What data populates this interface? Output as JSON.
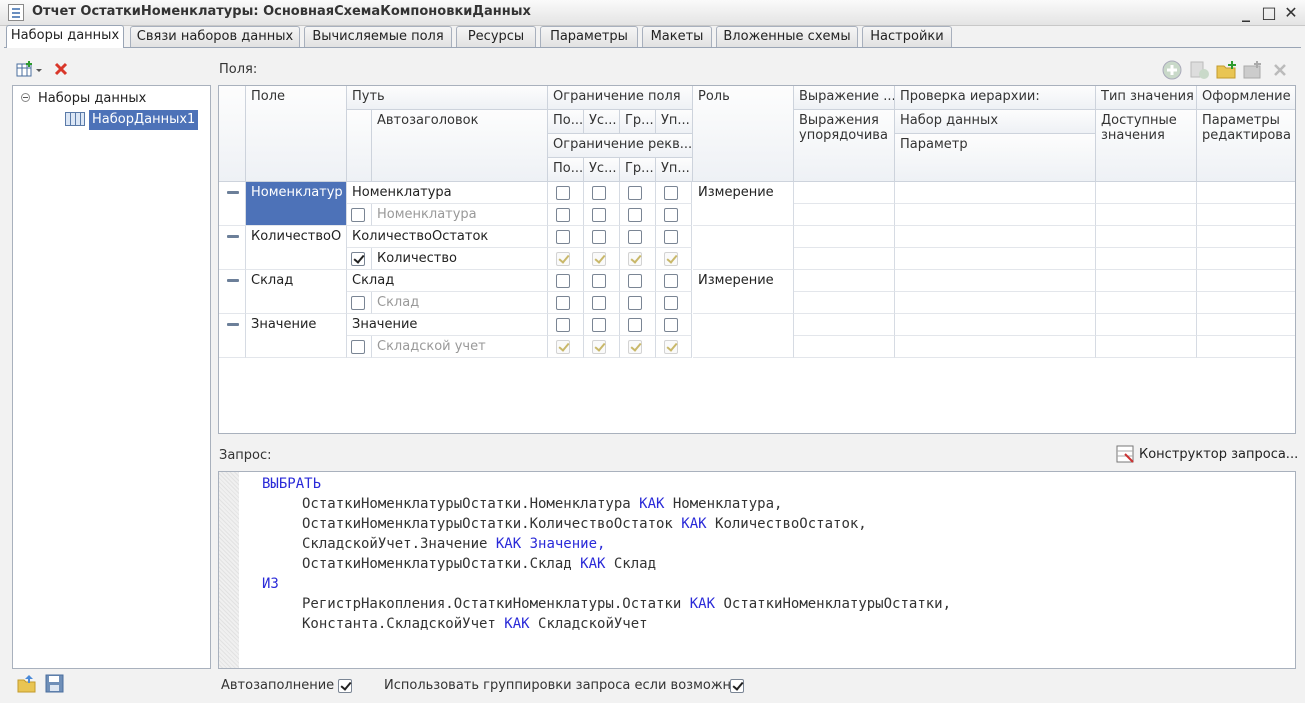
{
  "window": {
    "title": "Отчет ОстаткиНоменклатуры: ОсновнаяСхемаКомпоновкиДанных"
  },
  "tabs": [
    {
      "label": "Наборы данных"
    },
    {
      "label": "Связи наборов данных"
    },
    {
      "label": "Вычисляемые поля"
    },
    {
      "label": "Ресурсы"
    },
    {
      "label": "Параметры"
    },
    {
      "label": "Макеты"
    },
    {
      "label": "Вложенные схемы"
    },
    {
      "label": "Настройки"
    }
  ],
  "tree": {
    "root": "Наборы данных",
    "child": "НаборДанных1"
  },
  "fields_label": "Поля:",
  "grid": {
    "headers": {
      "pole": "Поле",
      "put": "Путь",
      "autozag": "Автозаголовок",
      "ogr_polya": "Ограничение поля",
      "ogr_rekv": "Ограничение рекв...",
      "sub_po": "По...",
      "sub_us": "Ус...",
      "sub_gr": "Гр...",
      "sub_up": "Уп...",
      "rol": "Роль",
      "vyrazh": "Выражение ...",
      "vyrazh_upor": "Выражения упорядочива",
      "proverka": "Проверка иерархии:",
      "nabor": "Набор данных",
      "parametr": "Параметр",
      "tip": "Тип значения",
      "dostupnye": "Доступные значения",
      "oformlenie": "Оформление",
      "param_red": "Параметры редактирова"
    },
    "rows": [
      {
        "field": "Номенклатур",
        "path": "Номенклатура",
        "title": "Номенклатура",
        "title_checked": false,
        "title_gray": true,
        "role": "Измерение",
        "req_enabled": true
      },
      {
        "field": "КоличествоО",
        "path": "КоличествоОстаток",
        "title": "Количество",
        "title_checked": true,
        "title_gray": false,
        "role": "",
        "req_enabled": false
      },
      {
        "field": "Склад",
        "path": "Склад",
        "title": "Склад",
        "title_checked": false,
        "title_gray": true,
        "role": "Измерение",
        "req_enabled": true
      },
      {
        "field": "Значение",
        "path": "Значение",
        "title": "Складской учет",
        "title_checked": false,
        "title_gray": true,
        "role": "",
        "req_enabled": false
      }
    ]
  },
  "query": {
    "label": "Запрос:",
    "constructor_label": "Конструктор запроса...",
    "lines": [
      {
        "indent": 0,
        "parts": [
          {
            "t": "ВЫБРАТЬ",
            "kw": true
          }
        ]
      },
      {
        "indent": 1,
        "parts": [
          {
            "t": "ОстаткиНоменклатурыОстатки.Номенклатура ",
            "kw": false
          },
          {
            "t": "КАК",
            "kw": true
          },
          {
            "t": " Номенклатура,",
            "kw": false
          }
        ]
      },
      {
        "indent": 1,
        "parts": [
          {
            "t": "ОстаткиНоменклатурыОстатки.КоличествоОстаток ",
            "kw": false
          },
          {
            "t": "КАК",
            "kw": true
          },
          {
            "t": " КоличествоОстаток,",
            "kw": false
          }
        ]
      },
      {
        "indent": 1,
        "parts": [
          {
            "t": "СкладскойУчет.Значение ",
            "kw": false
          },
          {
            "t": "КАК Значение,",
            "kw": true
          }
        ]
      },
      {
        "indent": 1,
        "parts": [
          {
            "t": "ОстаткиНоменклатурыОстатки.Склад ",
            "kw": false
          },
          {
            "t": "КАК",
            "kw": true
          },
          {
            "t": " Склад",
            "kw": false
          }
        ]
      },
      {
        "indent": 0,
        "parts": [
          {
            "t": "ИЗ",
            "kw": true
          }
        ]
      },
      {
        "indent": 1,
        "parts": [
          {
            "t": "РегистрНакопления.ОстаткиНоменклатуры.Остатки ",
            "kw": false
          },
          {
            "t": "КАК",
            "kw": true
          },
          {
            "t": " ОстаткиНоменклатурыОстатки,",
            "kw": false
          }
        ]
      },
      {
        "indent": 1,
        "parts": [
          {
            "t": "Константа.СкладскойУчет ",
            "kw": false
          },
          {
            "t": "КАК",
            "kw": true
          },
          {
            "t": " СкладскойУчет",
            "kw": false
          }
        ]
      }
    ]
  },
  "bottom": {
    "autofill_label": "Автозаполнение",
    "autofill_checked": true,
    "grouping_label": "Использовать группировки запроса если возможн...",
    "grouping_checked": true
  }
}
